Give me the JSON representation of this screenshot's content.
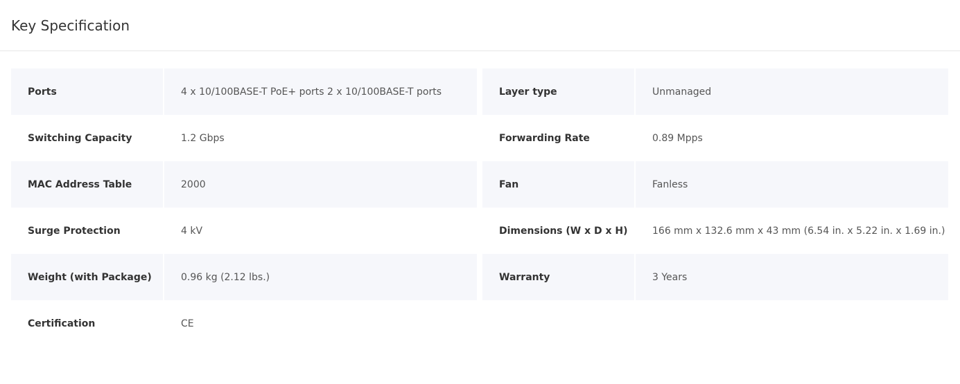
{
  "header": {
    "title": "Key Specification"
  },
  "specs": {
    "rows": [
      {
        "left": {
          "label": "Ports",
          "value": "4 x 10/100BASE-T PoE+ ports 2 x 10/100BASE-T ports"
        },
        "right": {
          "label": "Layer type",
          "value": "Unmanaged"
        }
      },
      {
        "left": {
          "label": "Switching Capacity",
          "value": "1.2 Gbps"
        },
        "right": {
          "label": "Forwarding Rate",
          "value": "0.89 Mpps"
        }
      },
      {
        "left": {
          "label": "MAC Address Table",
          "value": "2000"
        },
        "right": {
          "label": "Fan",
          "value": "Fanless"
        }
      },
      {
        "left": {
          "label": "Surge Protection",
          "value": "4 kV"
        },
        "right": {
          "label": "Dimensions (W x D x H)",
          "value": "166 mm x 132.6 mm x 43 mm (6.54 in. x 5.22 in. x 1.69 in.)"
        }
      },
      {
        "left": {
          "label": "Weight (with Package)",
          "value": "0.96 kg (2.12 lbs.)"
        },
        "right": {
          "label": "Warranty",
          "value": "3 Years"
        }
      },
      {
        "left": {
          "label": "Certification",
          "value": "CE"
        }
      }
    ]
  },
  "colors": {
    "row_shade": "#f6f7fb",
    "label_text": "#333333",
    "value_text": "#555555",
    "divider": "#e6e6e6"
  }
}
